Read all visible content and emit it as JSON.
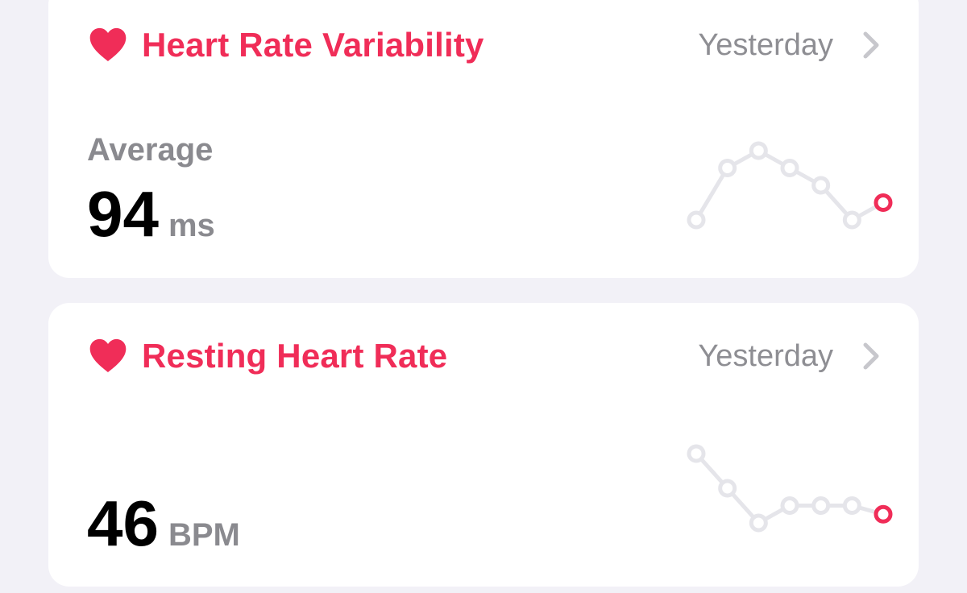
{
  "cards": [
    {
      "title": "Heart Rate Variability",
      "date": "Yesterday",
      "summary_label": "Average",
      "value": "94",
      "unit": "ms",
      "trend_points": [
        1,
        4,
        5,
        4,
        3,
        1,
        2
      ]
    },
    {
      "title": "Resting Heart Rate",
      "date": "Yesterday",
      "summary_label": "",
      "value": "46",
      "unit": "BPM",
      "trend_points": [
        5,
        3,
        1,
        2,
        2,
        2,
        1.5
      ]
    }
  ],
  "colors": {
    "accent": "#f02d58",
    "secondary_text": "#8e8e93",
    "background": "#f2f1f7",
    "card": "#ffffff",
    "spark_line": "#e5e5ea"
  },
  "icons": {
    "heart": "heart-icon",
    "chevron": "chevron-right-icon"
  }
}
